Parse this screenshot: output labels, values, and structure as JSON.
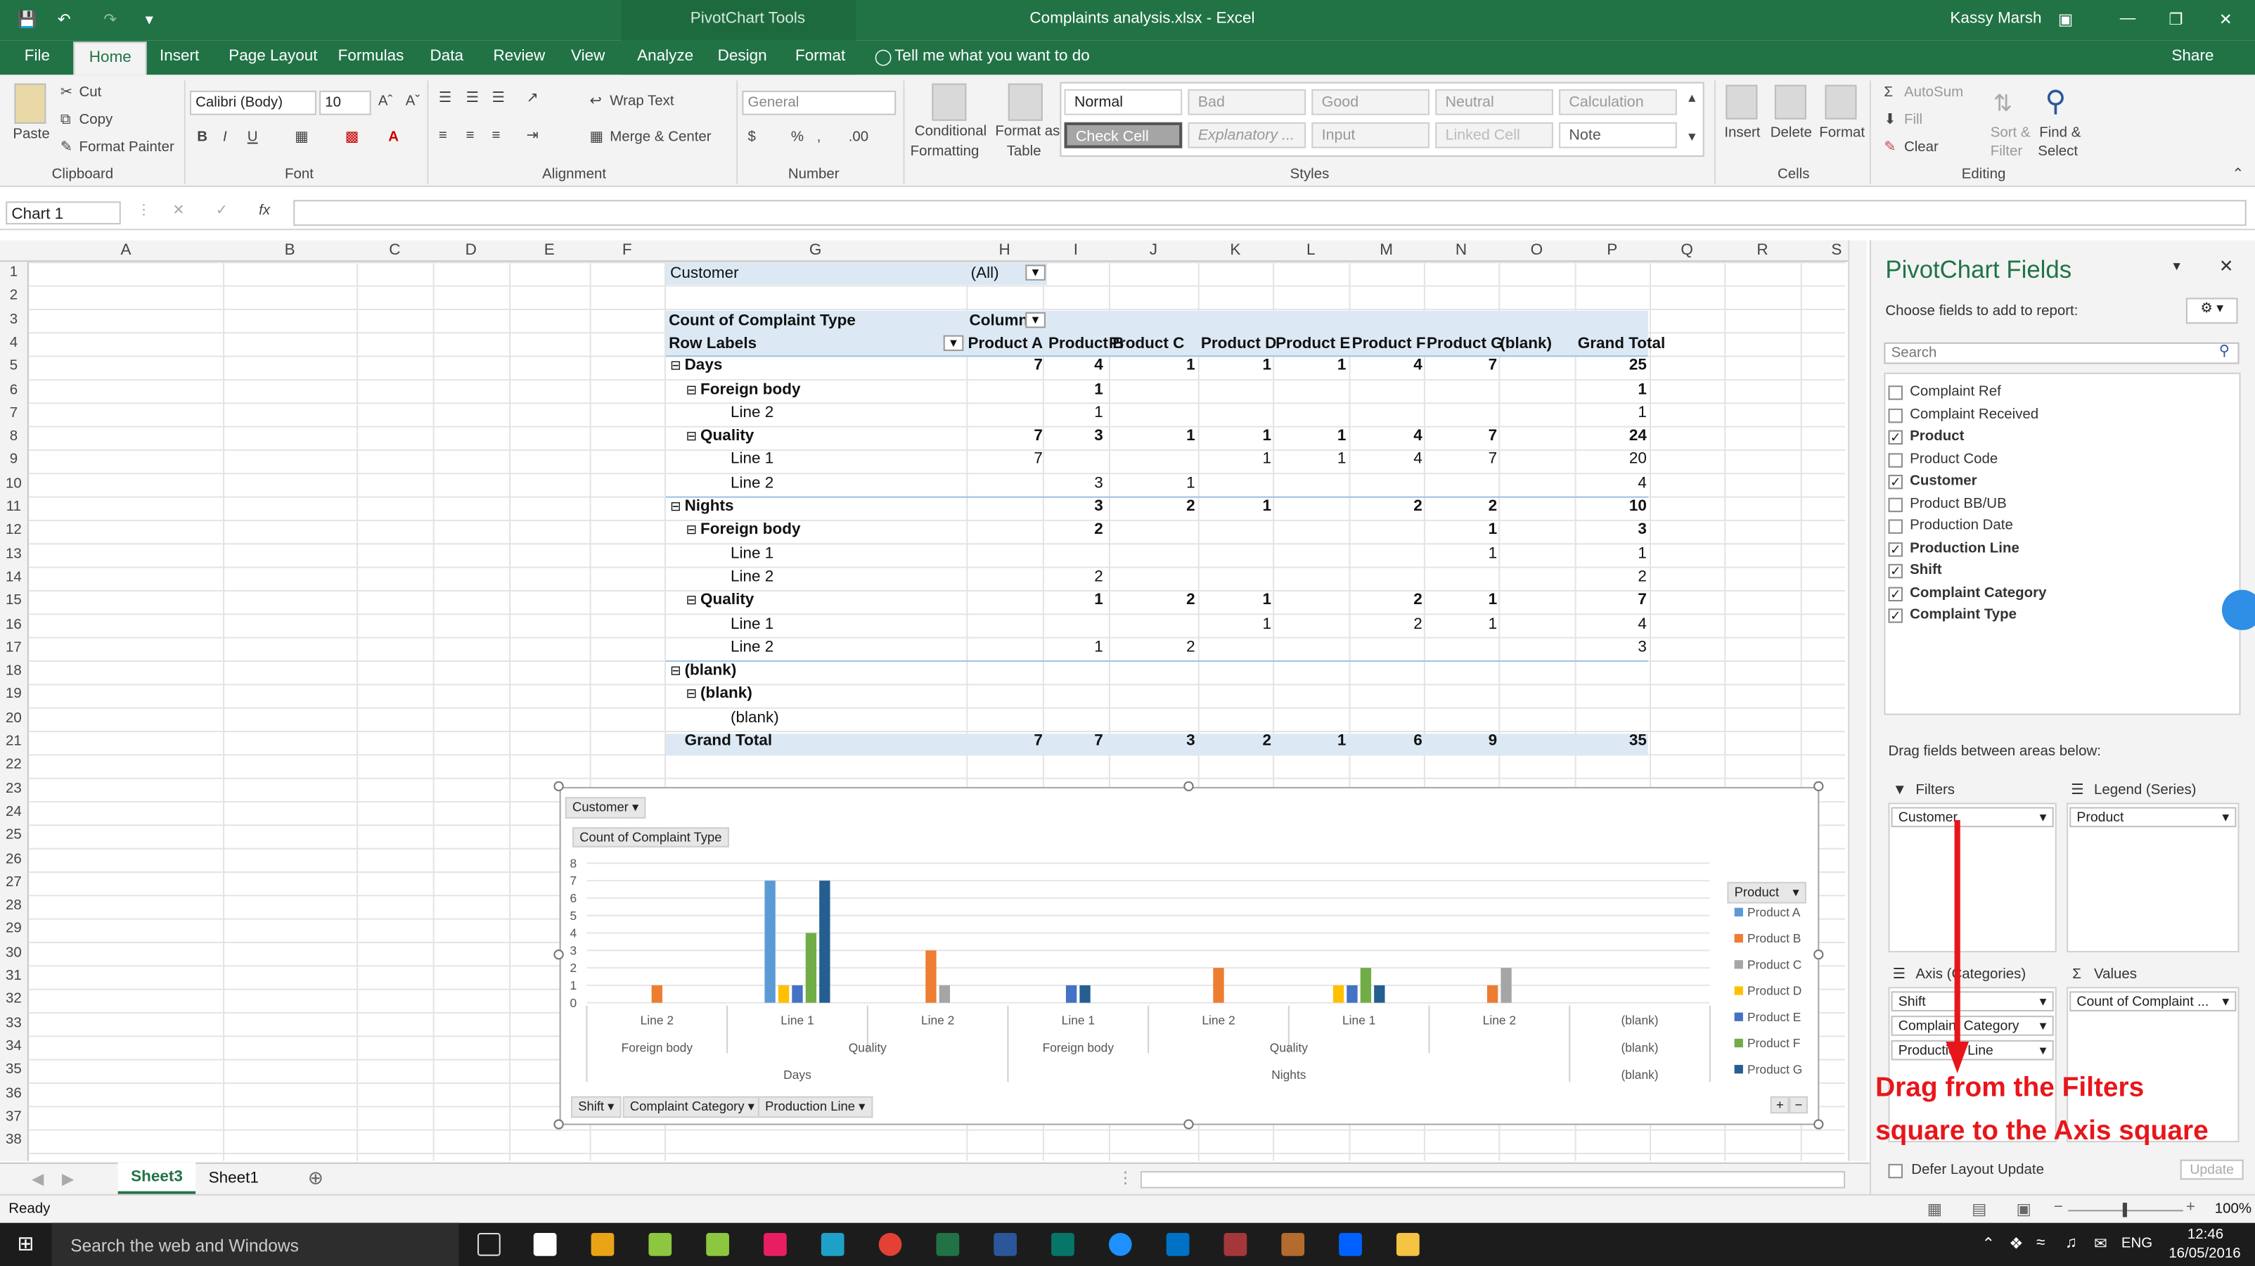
{
  "title_bar": {
    "contextual": "PivotChart Tools",
    "filename": "Complaints analysis.xlsx - Excel",
    "user": "Kassy Marsh"
  },
  "tabs": [
    "File",
    "Home",
    "Insert",
    "Page Layout",
    "Formulas",
    "Data",
    "Review",
    "View",
    "Analyze",
    "Design",
    "Format"
  ],
  "tell_me": "Tell me what you want to do",
  "share": "Share",
  "ribbon": {
    "clipboard": {
      "paste": "Paste",
      "cut": "Cut",
      "copy": "Copy",
      "format_painter": "Format Painter",
      "group": "Clipboard"
    },
    "font": {
      "name": "Calibri (Body)",
      "size": "10",
      "group": "Font"
    },
    "alignment": {
      "wrap": "Wrap Text",
      "merge": "Merge & Center",
      "group": "Alignment"
    },
    "number": {
      "format": "General",
      "group": "Number"
    },
    "styles": {
      "conditional": "Conditional",
      "conditional2": "Formatting",
      "format_as": "Format as",
      "format_as2": "Table",
      "cells": [
        "Normal",
        "Bad",
        "Good",
        "Neutral",
        "Calculation",
        "Check Cell",
        "Explanatory ...",
        "Input",
        "Linked Cell",
        "Note"
      ],
      "group": "Styles"
    },
    "cells": {
      "insert": "Insert",
      "delete": "Delete",
      "format": "Format",
      "group": "Cells"
    },
    "editing": {
      "autosum": "AutoSum",
      "fill": "Fill",
      "clear": "Clear",
      "sort": "Sort &",
      "sort2": "Filter",
      "find": "Find &",
      "find2": "Select",
      "group": "Editing"
    }
  },
  "name_box": "Chart 1",
  "fx": "fx",
  "columns": [
    "A",
    "B",
    "C",
    "D",
    "E",
    "F",
    "G",
    "H",
    "I",
    "J",
    "K",
    "L",
    "M",
    "N",
    "O",
    "P",
    "Q",
    "R",
    "S"
  ],
  "rows": [
    "1",
    "2",
    "3",
    "4",
    "5",
    "6",
    "7",
    "8",
    "9",
    "10",
    "11",
    "12",
    "13",
    "14",
    "15",
    "16",
    "17",
    "18",
    "19",
    "20",
    "21",
    "22",
    "23",
    "24",
    "25",
    "26",
    "27",
    "28",
    "29",
    "30",
    "31",
    "32",
    "33",
    "34",
    "35",
    "36",
    "37",
    "38"
  ],
  "pivot": {
    "filter_label": "Customer",
    "filter_value": "(All)",
    "count_label": "Count of Complaint Type",
    "column_label": "Column",
    "row_labels": "Row Labels",
    "headers": [
      "Product A",
      "Product B",
      "Product C",
      "Product D",
      "Product E",
      "Product F",
      "Product G",
      "(blank)",
      "Grand Total"
    ],
    "rows": [
      {
        "label": "Days",
        "indent": 0,
        "bold": true,
        "minus": true,
        "vals": [
          "7",
          "4",
          "1",
          "1",
          "1",
          "4",
          "7",
          "",
          "25"
        ]
      },
      {
        "label": "Foreign body",
        "indent": 1,
        "bold": true,
        "minus": true,
        "vals": [
          "",
          "1",
          "",
          "",
          "",
          "",
          "",
          "",
          "1"
        ]
      },
      {
        "label": "Line 2",
        "indent": 2,
        "bold": false,
        "minus": false,
        "vals": [
          "",
          "1",
          "",
          "",
          "",
          "",
          "",
          "",
          "1"
        ]
      },
      {
        "label": "Quality",
        "indent": 1,
        "bold": true,
        "minus": true,
        "vals": [
          "7",
          "3",
          "1",
          "1",
          "1",
          "4",
          "7",
          "",
          "24"
        ]
      },
      {
        "label": "Line 1",
        "indent": 2,
        "bold": false,
        "minus": false,
        "vals": [
          "7",
          "",
          "",
          "1",
          "1",
          "4",
          "7",
          "",
          "20"
        ]
      },
      {
        "label": "Line 2",
        "indent": 2,
        "bold": false,
        "minus": false,
        "vals": [
          "",
          "3",
          "1",
          "",
          "",
          "",
          "",
          "",
          "4"
        ]
      },
      {
        "label": "Nights",
        "indent": 0,
        "bold": true,
        "minus": true,
        "vals": [
          "",
          "3",
          "2",
          "1",
          "",
          "2",
          "2",
          "",
          "10"
        ]
      },
      {
        "label": "Foreign body",
        "indent": 1,
        "bold": true,
        "minus": true,
        "vals": [
          "",
          "2",
          "",
          "",
          "",
          "",
          "1",
          "",
          "3"
        ]
      },
      {
        "label": "Line 1",
        "indent": 2,
        "bold": false,
        "minus": false,
        "vals": [
          "",
          "",
          "",
          "",
          "",
          "",
          "1",
          "",
          "1"
        ]
      },
      {
        "label": "Line 2",
        "indent": 2,
        "bold": false,
        "minus": false,
        "vals": [
          "",
          "2",
          "",
          "",
          "",
          "",
          "",
          "",
          "2"
        ]
      },
      {
        "label": "Quality",
        "indent": 1,
        "bold": true,
        "minus": true,
        "vals": [
          "",
          "1",
          "2",
          "1",
          "",
          "2",
          "1",
          "",
          "7"
        ]
      },
      {
        "label": "Line 1",
        "indent": 2,
        "bold": false,
        "minus": false,
        "vals": [
          "",
          "",
          "",
          "1",
          "",
          "2",
          "1",
          "",
          "4"
        ]
      },
      {
        "label": "Line 2",
        "indent": 2,
        "bold": false,
        "minus": false,
        "vals": [
          "",
          "1",
          "2",
          "",
          "",
          "",
          "",
          "",
          "3"
        ]
      },
      {
        "label": "(blank)",
        "indent": 0,
        "bold": true,
        "minus": true,
        "vals": [
          "",
          "",
          "",
          "",
          "",
          "",
          "",
          "",
          ""
        ]
      },
      {
        "label": "(blank)",
        "indent": 1,
        "bold": true,
        "minus": true,
        "vals": [
          "",
          "",
          "",
          "",
          "",
          "",
          "",
          "",
          ""
        ]
      },
      {
        "label": "(blank)",
        "indent": 2,
        "bold": false,
        "minus": false,
        "vals": [
          "",
          "",
          "",
          "",
          "",
          "",
          "",
          "",
          ""
        ]
      },
      {
        "label": "Grand Total",
        "indent": 0,
        "bold": true,
        "minus": false,
        "vals": [
          "7",
          "7",
          "3",
          "2",
          "1",
          "6",
          "9",
          "",
          "35"
        ]
      }
    ]
  },
  "chart_data": {
    "type": "bar",
    "filter_button": "Customer",
    "value_button": "Count of Complaint Type",
    "axis_buttons": [
      "Shift",
      "Complaint Category",
      "Production Line"
    ],
    "legend_title": "Product",
    "ylim": [
      0,
      8
    ],
    "yticks": [
      "0",
      "1",
      "2",
      "3",
      "4",
      "5",
      "6",
      "7",
      "8"
    ],
    "categories": [
      {
        "line": "Line 2",
        "cat": "Foreign body",
        "shift": "Days"
      },
      {
        "line": "Line 1",
        "cat": "Quality",
        "shift": "Days"
      },
      {
        "line": "Line 2",
        "cat": "Quality",
        "shift": "Days"
      },
      {
        "line": "Line 1",
        "cat": "Foreign body",
        "shift": "Nights"
      },
      {
        "line": "Line 2",
        "cat": "Foreign body",
        "shift": "Nights"
      },
      {
        "line": "Line 1",
        "cat": "Quality",
        "shift": "Nights"
      },
      {
        "line": "Line 2",
        "cat": "Quality",
        "shift": "Nights"
      },
      {
        "line": "(blank)",
        "cat": "(blank)",
        "shift": "(blank)"
      }
    ],
    "group_labels": {
      "cat": [
        "Foreign body",
        "Quality",
        "Foreign body",
        "Quality",
        "(blank)"
      ],
      "shift": [
        "Days",
        "Nights",
        "(blank)"
      ]
    },
    "series": [
      {
        "name": "Product A",
        "color": "#5b9bd5",
        "values": [
          0,
          7,
          0,
          0,
          0,
          0,
          0,
          0
        ]
      },
      {
        "name": "Product B",
        "color": "#ed7d31",
        "values": [
          1,
          0,
          3,
          0,
          2,
          0,
          1,
          0
        ]
      },
      {
        "name": "Product C",
        "color": "#a5a5a5",
        "values": [
          0,
          0,
          1,
          0,
          0,
          0,
          2,
          0
        ]
      },
      {
        "name": "Product D",
        "color": "#ffc000",
        "values": [
          0,
          1,
          0,
          0,
          0,
          1,
          0,
          0
        ]
      },
      {
        "name": "Product E",
        "color": "#4472c4",
        "values": [
          0,
          1,
          0,
          1,
          0,
          1,
          0,
          0
        ]
      },
      {
        "name": "Product F",
        "color": "#70ad47",
        "values": [
          0,
          4,
          0,
          0,
          0,
          2,
          0,
          0
        ]
      },
      {
        "name": "Product G",
        "color": "#255e91",
        "values": [
          0,
          7,
          0,
          1,
          0,
          1,
          0,
          0
        ]
      }
    ]
  },
  "pane": {
    "title": "PivotChart Fields",
    "subtitle": "Choose fields to add to report:",
    "search_placeholder": "Search",
    "fields": [
      {
        "name": "Complaint Ref",
        "checked": false
      },
      {
        "name": "Complaint Received",
        "checked": false
      },
      {
        "name": "Product",
        "checked": true
      },
      {
        "name": "Product Code",
        "checked": false
      },
      {
        "name": "Customer",
        "checked": true
      },
      {
        "name": "Product BB/UB",
        "checked": false
      },
      {
        "name": "Production Date",
        "checked": false
      },
      {
        "name": "Production Line",
        "checked": true
      },
      {
        "name": "Shift",
        "checked": true
      },
      {
        "name": "Complaint Category",
        "checked": true
      },
      {
        "name": "Complaint Type",
        "checked": true
      }
    ],
    "drag_hint": "Drag fields between areas below:",
    "filters_title": "Filters",
    "filters_item": "Customer",
    "legend_title": "Legend (Series)",
    "legend_item": "Product",
    "axis_title": "Axis (Categories)",
    "axis_items": [
      "Shift",
      "Complaint Category",
      "Production Line"
    ],
    "values_title": "Values",
    "values_item": "Count of Complaint ...",
    "defer": "Defer Layout Update",
    "update": "Update"
  },
  "sheets": [
    "Sheet3",
    "Sheet1"
  ],
  "status": {
    "ready": "Ready",
    "zoom": "100%"
  },
  "taskbar": {
    "search": "Search the web and Windows",
    "lang": "ENG",
    "time": "12:46",
    "date": "16/05/2016"
  },
  "annotation": [
    "Drag from the Filters",
    "square to the Axis square"
  ]
}
